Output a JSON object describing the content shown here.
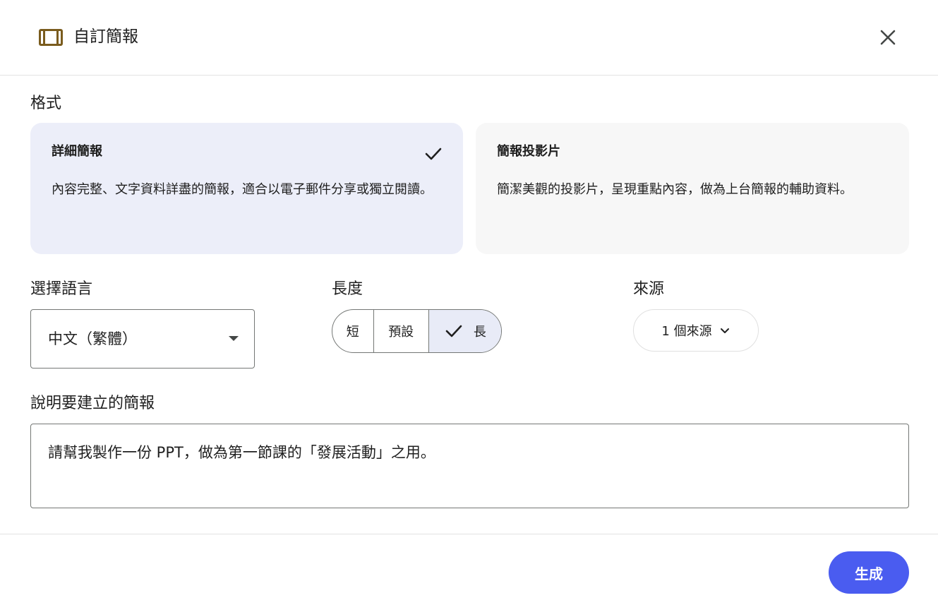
{
  "dialog": {
    "title": "自訂簡報",
    "icon": "slides-icon",
    "close_icon": "close-icon"
  },
  "format": {
    "label": "格式",
    "options": [
      {
        "title": "詳細簡報",
        "description": "內容完整、文字資料詳盡的簡報，適合以電子郵件分享或獨立閱讀。",
        "selected": true
      },
      {
        "title": "簡報投影片",
        "description": "簡潔美觀的投影片，呈現重點內容，做為上台簡報的輔助資料。",
        "selected": false
      }
    ]
  },
  "language": {
    "label": "選擇語言",
    "value": "中文（繁體）"
  },
  "length": {
    "label": "長度",
    "options": [
      "短",
      "預設",
      "長"
    ],
    "selected_index": 2
  },
  "source": {
    "label": "來源",
    "value": "1 個來源"
  },
  "prompt": {
    "label": "說明要建立的簡報",
    "value": "請幫我製作一份 PPT，做為第一節課的「發展活動」之用。"
  },
  "footer": {
    "generate_label": "生成"
  },
  "colors": {
    "accent": "#4a5cf0",
    "selected_card": "#eceef9",
    "icon_brown": "#7a5c1e"
  }
}
